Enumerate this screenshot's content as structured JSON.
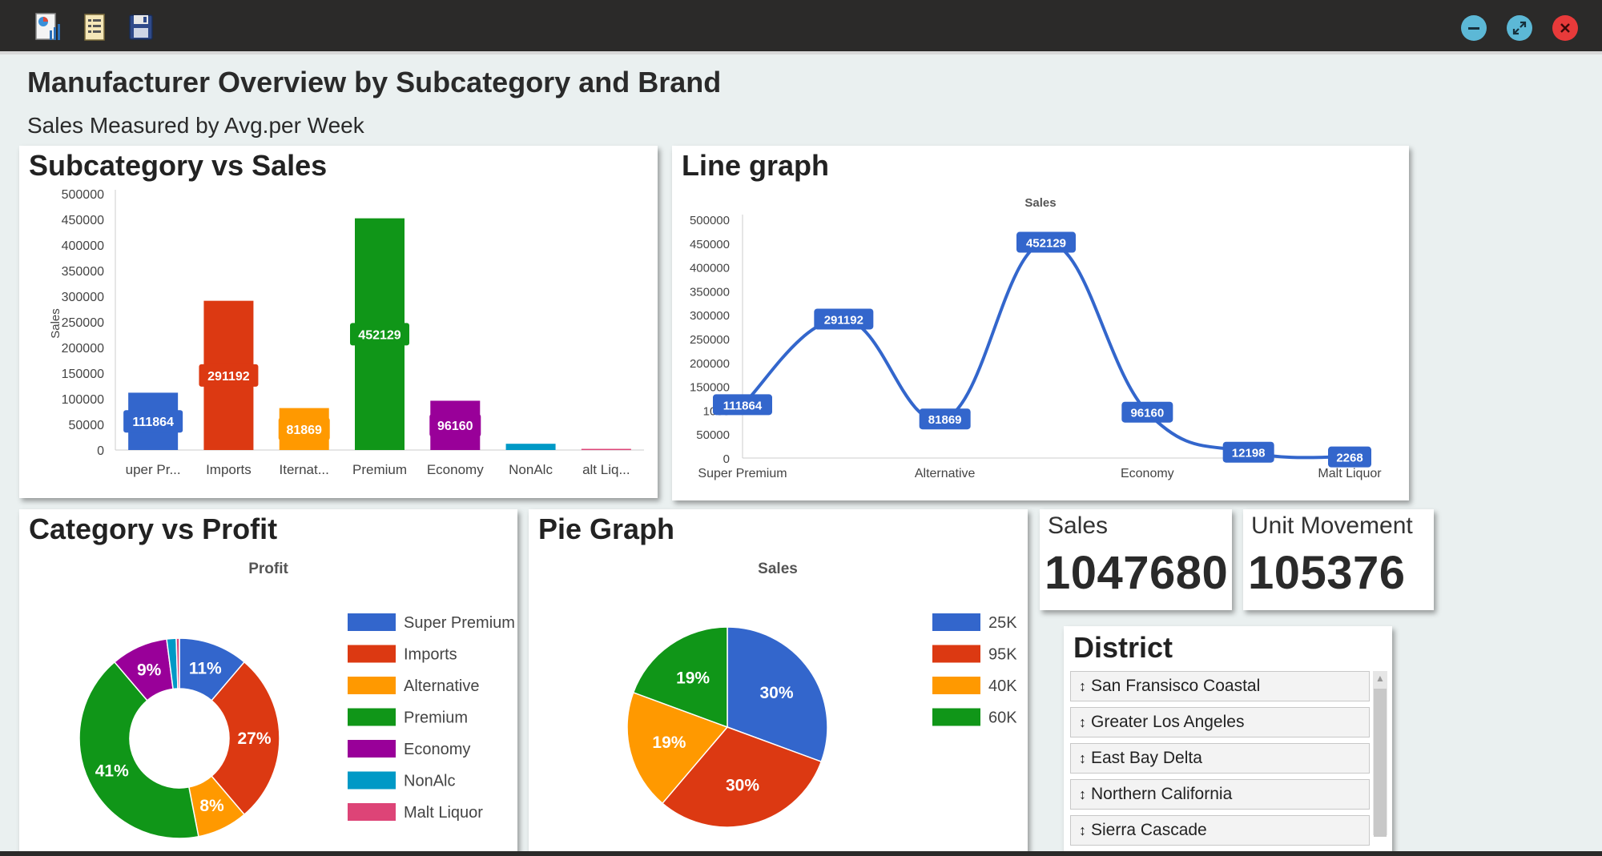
{
  "window": {
    "toolbar_icons": [
      "report-chart-icon",
      "document-list-icon",
      "floppy-save-icon"
    ],
    "controls": [
      "minimize-icon",
      "maximize-icon",
      "close-icon"
    ]
  },
  "header": {
    "title": "Manufacturer Overview by Subcategory and Brand",
    "subtitle": "Sales Measured by Avg.per Week"
  },
  "bar_card": {
    "title": "Subcategory vs Sales"
  },
  "line_card": {
    "title": "Line graph"
  },
  "donut_card": {
    "title": "Category vs Profit"
  },
  "pie_card": {
    "title": "Pie Graph"
  },
  "kpis": {
    "sales": {
      "label": "Sales",
      "value": "1047680"
    },
    "units": {
      "label": "Unit Movement",
      "value": "105376"
    }
  },
  "district": {
    "title": "District",
    "items": [
      "San Fransisco Coastal",
      "Greater Los Angeles",
      "East Bay Delta",
      "Northern California",
      "Sierra Cascade"
    ]
  },
  "colors": {
    "blue": "#3366cc",
    "red": "#dc3912",
    "orange": "#ff9900",
    "green": "#109618",
    "purple": "#990099",
    "teal": "#0099c6",
    "pink": "#dd4477"
  },
  "chart_data": [
    {
      "type": "bar",
      "title": "Subcategory vs Sales",
      "ylabel": "Sales",
      "xlabel": "",
      "ylim": [
        0,
        500000
      ],
      "yticks": [
        "500000",
        "450000",
        "400000",
        "350000",
        "300000",
        "250000",
        "200000",
        "150000",
        "100000",
        "50000",
        "0"
      ],
      "categories": [
        "uper Pr...",
        "Imports",
        "Iternat...",
        "Premium",
        "Economy",
        "NonAlc",
        "alt Liq..."
      ],
      "values": [
        111864,
        291192,
        81869,
        452129,
        96160,
        12198,
        2268
      ],
      "data_labels": [
        "111864",
        "291192",
        "81869",
        "452129",
        "96160",
        "",
        ""
      ],
      "colors": [
        "#3366cc",
        "#dc3912",
        "#ff9900",
        "#109618",
        "#990099",
        "#0099c6",
        "#dd4477"
      ],
      "grid": false,
      "legend": "none"
    },
    {
      "type": "line",
      "title": "Sales",
      "ylim": [
        0,
        500000
      ],
      "yticks": [
        "500000",
        "450000",
        "400000",
        "350000",
        "300000",
        "250000",
        "200000",
        "150000",
        "1000",
        "50000",
        "0"
      ],
      "categories": [
        "Super Premium",
        "Imports",
        "Alternative",
        "Premium",
        "Economy",
        "NonAlc",
        "Malt Liquor"
      ],
      "x_tick_labels": [
        "Super Premium",
        "Alternative",
        "Economy",
        "Malt Liquor"
      ],
      "values": [
        111864,
        291192,
        81869,
        452129,
        96160,
        12198,
        2268
      ],
      "data_labels": [
        "111864",
        "291192",
        "81869",
        "452129",
        "96160",
        "12198",
        "2268"
      ],
      "color": "#3366cc",
      "grid": false,
      "legend": "none"
    },
    {
      "type": "pie",
      "title": "Profit",
      "donut": true,
      "labels": [
        "Super Premium",
        "Imports",
        "Alternative",
        "Premium",
        "Economy",
        "NonAlc",
        "Malt Liquor"
      ],
      "values": [
        11,
        27,
        8,
        41,
        9,
        1.5,
        0.5
      ],
      "slice_labels": [
        "11%",
        "27%",
        "8%",
        "41%",
        "9%",
        "",
        ""
      ],
      "colors": [
        "#3366cc",
        "#dc3912",
        "#ff9900",
        "#109618",
        "#990099",
        "#0099c6",
        "#dd4477"
      ],
      "legend": "right"
    },
    {
      "type": "pie",
      "title": "Sales",
      "donut": false,
      "labels": [
        "25K",
        "95K",
        "40K",
        "60K"
      ],
      "values": [
        30,
        30,
        19,
        19
      ],
      "slice_labels": [
        "30%",
        "30%",
        "19%",
        "19%"
      ],
      "colors": [
        "#3366cc",
        "#dc3912",
        "#ff9900",
        "#109618"
      ],
      "legend": "right"
    }
  ]
}
